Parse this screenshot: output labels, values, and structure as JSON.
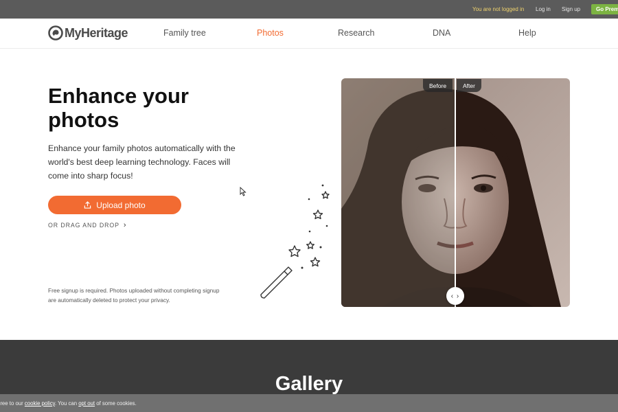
{
  "topbar": {
    "status": "You are not logged in",
    "login": "Log in",
    "signup": "Sign up",
    "premium": "Go Premium"
  },
  "nav": {
    "brand": "MyHeritage",
    "items": [
      {
        "label": "Family tree"
      },
      {
        "label": "Photos",
        "active": true
      },
      {
        "label": "Research"
      },
      {
        "label": "DNA"
      },
      {
        "label": "Help"
      }
    ]
  },
  "hero": {
    "title": "Enhance your photos",
    "description": "Enhance your family photos automatically with the world's best deep learning technology. Faces will come into sharp focus!",
    "upload_label": "Upload photo",
    "drag_label": "OR DRAG AND DROP",
    "fine_print": "Free signup is required. Photos uploaded without completing signup are automatically deleted to protect your privacy."
  },
  "compare": {
    "before_label": "Before",
    "after_label": "After",
    "handle_glyph": "‹ ›"
  },
  "gallery": {
    "title": "Gallery"
  },
  "cookie": {
    "prefix": "gree to our ",
    "policy_link": "cookie policy",
    "middle": ". You can ",
    "optout_link": "opt out",
    "suffix": " of some cookies."
  },
  "colors": {
    "accent": "#f26b32",
    "premium": "#7cb342",
    "topbar": "#5b5b5b",
    "status_text": "#f0d36e",
    "gallery_bg": "#3b3b3b"
  },
  "icons": [
    "myheritage-logo-icon",
    "upload-icon",
    "chevron-right-icon",
    "magic-wand-icon",
    "star-icon",
    "compare-handle-icon",
    "cursor-icon"
  ]
}
